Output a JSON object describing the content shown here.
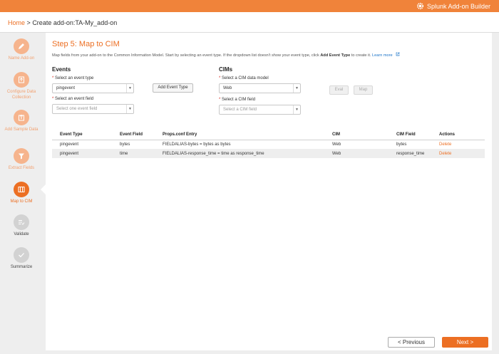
{
  "header": {
    "brand": "Splunk Add-on Builder"
  },
  "breadcrumb": {
    "home": "Home",
    "separator": ">",
    "current": "Create add-on:TA-My_add-on"
  },
  "sidebar": {
    "steps": [
      {
        "label": "Name Add-on",
        "status": "done",
        "icon": "pencil-icon"
      },
      {
        "label": "Configure Data Collection",
        "status": "done",
        "icon": "upload-icon"
      },
      {
        "label": "Add Sample Data",
        "status": "done",
        "icon": "upload-icon"
      },
      {
        "label": "Extract Fields",
        "status": "done",
        "icon": "funnel-icon"
      },
      {
        "label": "Map to CIM",
        "status": "active",
        "icon": "map-icon"
      },
      {
        "label": "Validate",
        "status": "todo",
        "icon": "list-check-icon"
      },
      {
        "label": "Summarize",
        "status": "todo",
        "icon": "checkmark-icon"
      }
    ]
  },
  "main": {
    "title": "Step 5: Map to CIM",
    "description_pre": "Map fields from your add-on to the Common Information Model. Start by selecting an event type. If the dropdown list doesn't show your event type, click ",
    "description_bold": "Add Event Type",
    "description_post": " to create it. ",
    "learn_more": "Learn more",
    "events": {
      "heading": "Events",
      "event_type_label": "Select an event type",
      "event_type_value": "pingevent",
      "event_field_label": "Select an event field",
      "event_field_placeholder": "Select one event field",
      "add_event_type": "Add Event Type"
    },
    "cims": {
      "heading": "CIMs",
      "data_model_label": "Select a CIM data model",
      "data_model_value": "Web",
      "cim_field_label": "Select a CIM field",
      "cim_field_placeholder": "Select a CIM field",
      "eval": "Eval",
      "map": "Map"
    },
    "table": {
      "columns": [
        "Event Type",
        "Event Field",
        "Props.conf Entry",
        "CIM",
        "CIM Field",
        "Actions"
      ],
      "rows": [
        [
          "pingevent",
          "bytes",
          "FIELDALIAS-bytes = bytes as bytes",
          "Web",
          "bytes",
          "Delete"
        ],
        [
          "pingevent",
          "time",
          "FIELDALIAS-response_time = time as response_time",
          "Web",
          "response_time",
          "Delete"
        ]
      ]
    }
  },
  "footer": {
    "previous": "< Previous",
    "next": "Next >"
  },
  "colors": {
    "accent": "#ec6f23",
    "topbar": "#f0833a",
    "link": "#1a73c8"
  }
}
